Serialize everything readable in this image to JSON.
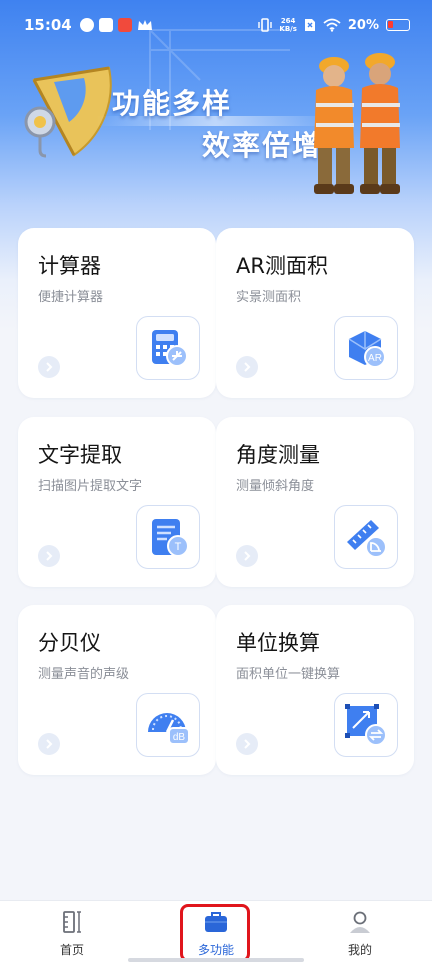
{
  "status_bar": {
    "time": "15:04",
    "net_speed_value": "264",
    "net_speed_unit": "KB/s",
    "battery": "20%"
  },
  "banner": {
    "line1": "功能多样",
    "line2": "效率倍增"
  },
  "cards": [
    {
      "title": "计算器",
      "subtitle": "便捷计算器",
      "icon": "calculator-icon"
    },
    {
      "title": "AR测面积",
      "subtitle": "实景测面积",
      "icon": "ar-cube-icon"
    },
    {
      "title": "文字提取",
      "subtitle": "扫描图片提取文字",
      "icon": "text-extract-icon"
    },
    {
      "title": "角度测量",
      "subtitle": "测量倾斜角度",
      "icon": "ruler-angle-icon"
    },
    {
      "title": "分贝仪",
      "subtitle": "测量声音的声级",
      "icon": "decibel-meter-icon"
    },
    {
      "title": "单位换算",
      "subtitle": "面积单位一键换算",
      "icon": "unit-convert-icon"
    }
  ],
  "ar_badge": "AR",
  "db_badge": "dB",
  "text_badge": "T",
  "bottom_nav": [
    {
      "label": "首页",
      "icon": "home-ruler-icon",
      "active": false
    },
    {
      "label": "多功能",
      "icon": "toolbox-icon",
      "active": true
    },
    {
      "label": "我的",
      "icon": "user-icon",
      "active": false
    }
  ],
  "colors": {
    "accent": "#2a66d8",
    "hero_top": "#3f82f0",
    "highlight": "#e0151c"
  }
}
